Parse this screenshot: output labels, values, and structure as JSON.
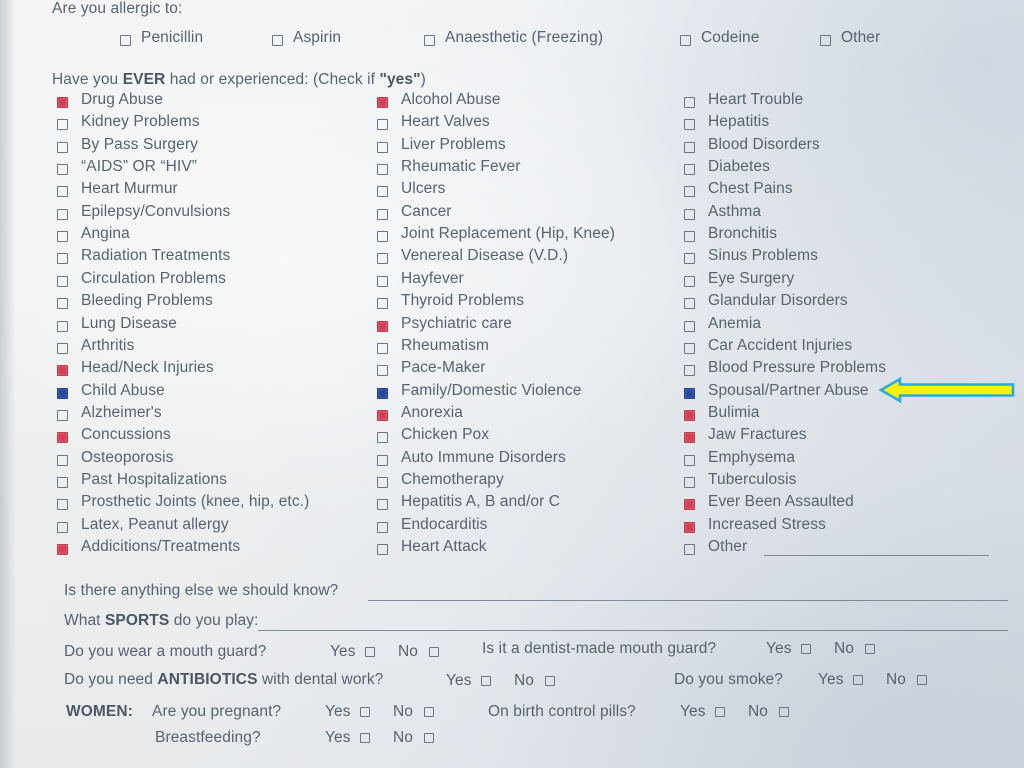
{
  "form": {
    "allergy_prompt": "Are you allergic to:",
    "allergies": [
      {
        "label": "Penicillin",
        "checked": false
      },
      {
        "label": "Aspirin",
        "checked": false
      },
      {
        "label": "Anaesthetic (Freezing)",
        "checked": false
      },
      {
        "label": "Codeine",
        "checked": false
      },
      {
        "label": "Other",
        "checked": false
      }
    ],
    "history_prompt_pre": "Have you ",
    "history_prompt_ever": "EVER",
    "history_prompt_mid": " had or experienced: (Check if ",
    "history_prompt_yes": "\"yes\"",
    "history_prompt_post": ")",
    "columns": [
      {
        "items": [
          {
            "label": "Drug Abuse",
            "state": "red"
          },
          {
            "label": "Kidney Problems",
            "state": "empty"
          },
          {
            "label": "By Pass Surgery",
            "state": "empty"
          },
          {
            "label": "“AIDS” OR “HIV”",
            "state": "empty"
          },
          {
            "label": "Heart Murmur",
            "state": "empty"
          },
          {
            "label": "Epilepsy/Convulsions",
            "state": "empty"
          },
          {
            "label": "Angina",
            "state": "empty"
          },
          {
            "label": "Radiation Treatments",
            "state": "empty"
          },
          {
            "label": "Circulation Problems",
            "state": "empty"
          },
          {
            "label": "Bleeding Problems",
            "state": "empty"
          },
          {
            "label": "Lung Disease",
            "state": "empty"
          },
          {
            "label": "Arthritis",
            "state": "empty"
          },
          {
            "label": "Head/Neck Injuries",
            "state": "red"
          },
          {
            "label": "Child Abuse",
            "state": "blue"
          },
          {
            "label": "Alzheimer's",
            "state": "empty"
          },
          {
            "label": "Concussions",
            "state": "red"
          },
          {
            "label": "Osteoporosis",
            "state": "empty"
          },
          {
            "label": "Past Hospitalizations",
            "state": "empty"
          },
          {
            "label": "Prosthetic Joints (knee, hip, etc.)",
            "state": "empty"
          },
          {
            "label": "Latex, Peanut allergy",
            "state": "empty"
          },
          {
            "label": "Addicitions/Treatments",
            "state": "red"
          }
        ]
      },
      {
        "items": [
          {
            "label": "Alcohol Abuse",
            "state": "red"
          },
          {
            "label": "Heart Valves",
            "state": "empty"
          },
          {
            "label": "Liver Problems",
            "state": "empty"
          },
          {
            "label": "Rheumatic Fever",
            "state": "empty"
          },
          {
            "label": "Ulcers",
            "state": "empty"
          },
          {
            "label": "Cancer",
            "state": "empty"
          },
          {
            "label": "Joint Replacement (Hip, Knee)",
            "state": "empty"
          },
          {
            "label": "Venereal Disease (V.D.)",
            "state": "empty"
          },
          {
            "label": "Hayfever",
            "state": "empty"
          },
          {
            "label": "Thyroid Problems",
            "state": "empty"
          },
          {
            "label": "Psychiatric care",
            "state": "red"
          },
          {
            "label": "Rheumatism",
            "state": "empty"
          },
          {
            "label": "Pace-Maker",
            "state": "empty"
          },
          {
            "label": "Family/Domestic Violence",
            "state": "blue"
          },
          {
            "label": "Anorexia",
            "state": "red"
          },
          {
            "label": "Chicken Pox",
            "state": "empty"
          },
          {
            "label": "Auto Immune Disorders",
            "state": "empty"
          },
          {
            "label": "Chemotherapy",
            "state": "empty"
          },
          {
            "label": "Hepatitis A, B and/or C",
            "state": "empty"
          },
          {
            "label": "Endocarditis",
            "state": "empty"
          },
          {
            "label": "Heart Attack",
            "state": "empty"
          }
        ]
      },
      {
        "items": [
          {
            "label": "Heart Trouble",
            "state": "empty"
          },
          {
            "label": "Hepatitis",
            "state": "empty"
          },
          {
            "label": "Blood Disorders",
            "state": "empty"
          },
          {
            "label": "Diabetes",
            "state": "empty"
          },
          {
            "label": "Chest Pains",
            "state": "empty"
          },
          {
            "label": "Asthma",
            "state": "empty"
          },
          {
            "label": "Bronchitis",
            "state": "empty"
          },
          {
            "label": "Sinus Problems",
            "state": "empty"
          },
          {
            "label": "Eye Surgery",
            "state": "empty"
          },
          {
            "label": "Glandular Disorders",
            "state": "empty"
          },
          {
            "label": "Anemia",
            "state": "empty"
          },
          {
            "label": "Car Accident Injuries",
            "state": "empty"
          },
          {
            "label": "Blood Pressure Problems",
            "state": "empty"
          },
          {
            "label": "Spousal/Partner Abuse",
            "state": "blue"
          },
          {
            "label": "Bulimia",
            "state": "red"
          },
          {
            "label": "Jaw Fractures",
            "state": "red"
          },
          {
            "label": "Emphysema",
            "state": "empty"
          },
          {
            "label": "Tuberculosis",
            "state": "empty"
          },
          {
            "label": "Ever Been Assaulted",
            "state": "red"
          },
          {
            "label": "Increased Stress",
            "state": "red"
          },
          {
            "label": "Other",
            "state": "empty",
            "has_blank_line": true
          }
        ]
      }
    ],
    "anything_else_label": "Is there anything else we should know?",
    "anything_else_value": "",
    "sports_pre": "What ",
    "sports_bold": "SPORTS",
    "sports_post": " do you play:",
    "sports_value": "",
    "mouth_guard_question": "Do you wear a mouth guard?",
    "dentist_made_question": "Is it a dentist-made mouth guard?",
    "antibiotics_pre": "Do you need ",
    "antibiotics_bold": "ANTIBIOTICS",
    "antibiotics_post": " with dental work?",
    "smoke_question": "Do you smoke?",
    "women_label": "WOMEN:",
    "pregnant_question": "Are you pregnant?",
    "birth_control_question": "On birth control pills?",
    "breastfeeding_question": "Breastfeeding?",
    "yes_label": "Yes",
    "no_label": "No"
  },
  "annotation": {
    "type": "arrow",
    "direction": "left",
    "points_at": "Spousal/Partner Abuse",
    "fill_color": "#FFF200",
    "stroke_color": "#29ABE2"
  }
}
